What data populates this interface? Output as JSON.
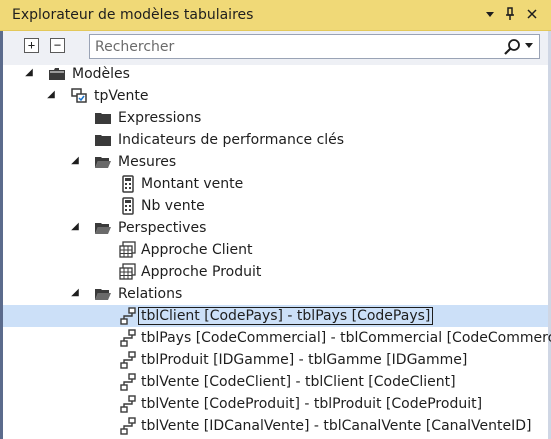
{
  "window": {
    "title": "Explorateur de modèles tabulaires",
    "controls": [
      "▾",
      "📌",
      "✕"
    ]
  },
  "toolbar": {
    "expand_label": "+",
    "collapse_label": "−",
    "search_placeholder": "Rechercher"
  },
  "tree": {
    "models": "Modèles",
    "model": "tpVente",
    "expressions": "Expressions",
    "kpis": "Indicateurs de performance clés",
    "measures": "Mesures",
    "measure_items": [
      "Montant vente",
      "Nb vente"
    ],
    "perspectives": "Perspectives",
    "perspective_items": [
      "Approche Client",
      "Approche Produit"
    ],
    "relations": "Relations",
    "relation_items": [
      "tblClient [CodePays] - tblPays [CodePays]",
      "tblPays [CodeCommercial] - tblCommercial [CodeCommercial]",
      "tblProduit [IDGamme] - tblGamme [IDGamme]",
      "tblVente [CodeClient] - tblClient [CodeClient]",
      "tblVente [CodeProduit] - tblProduit [CodeProduit]",
      "tblVente [IDCanalVente] - tblCanalVente [CanalVenteID]"
    ],
    "selected_relation": "tblClient [CodePays] - tblPays [CodePays]"
  },
  "colors": {
    "titlebar": "#f0d977",
    "selection": "#cce0f8"
  }
}
